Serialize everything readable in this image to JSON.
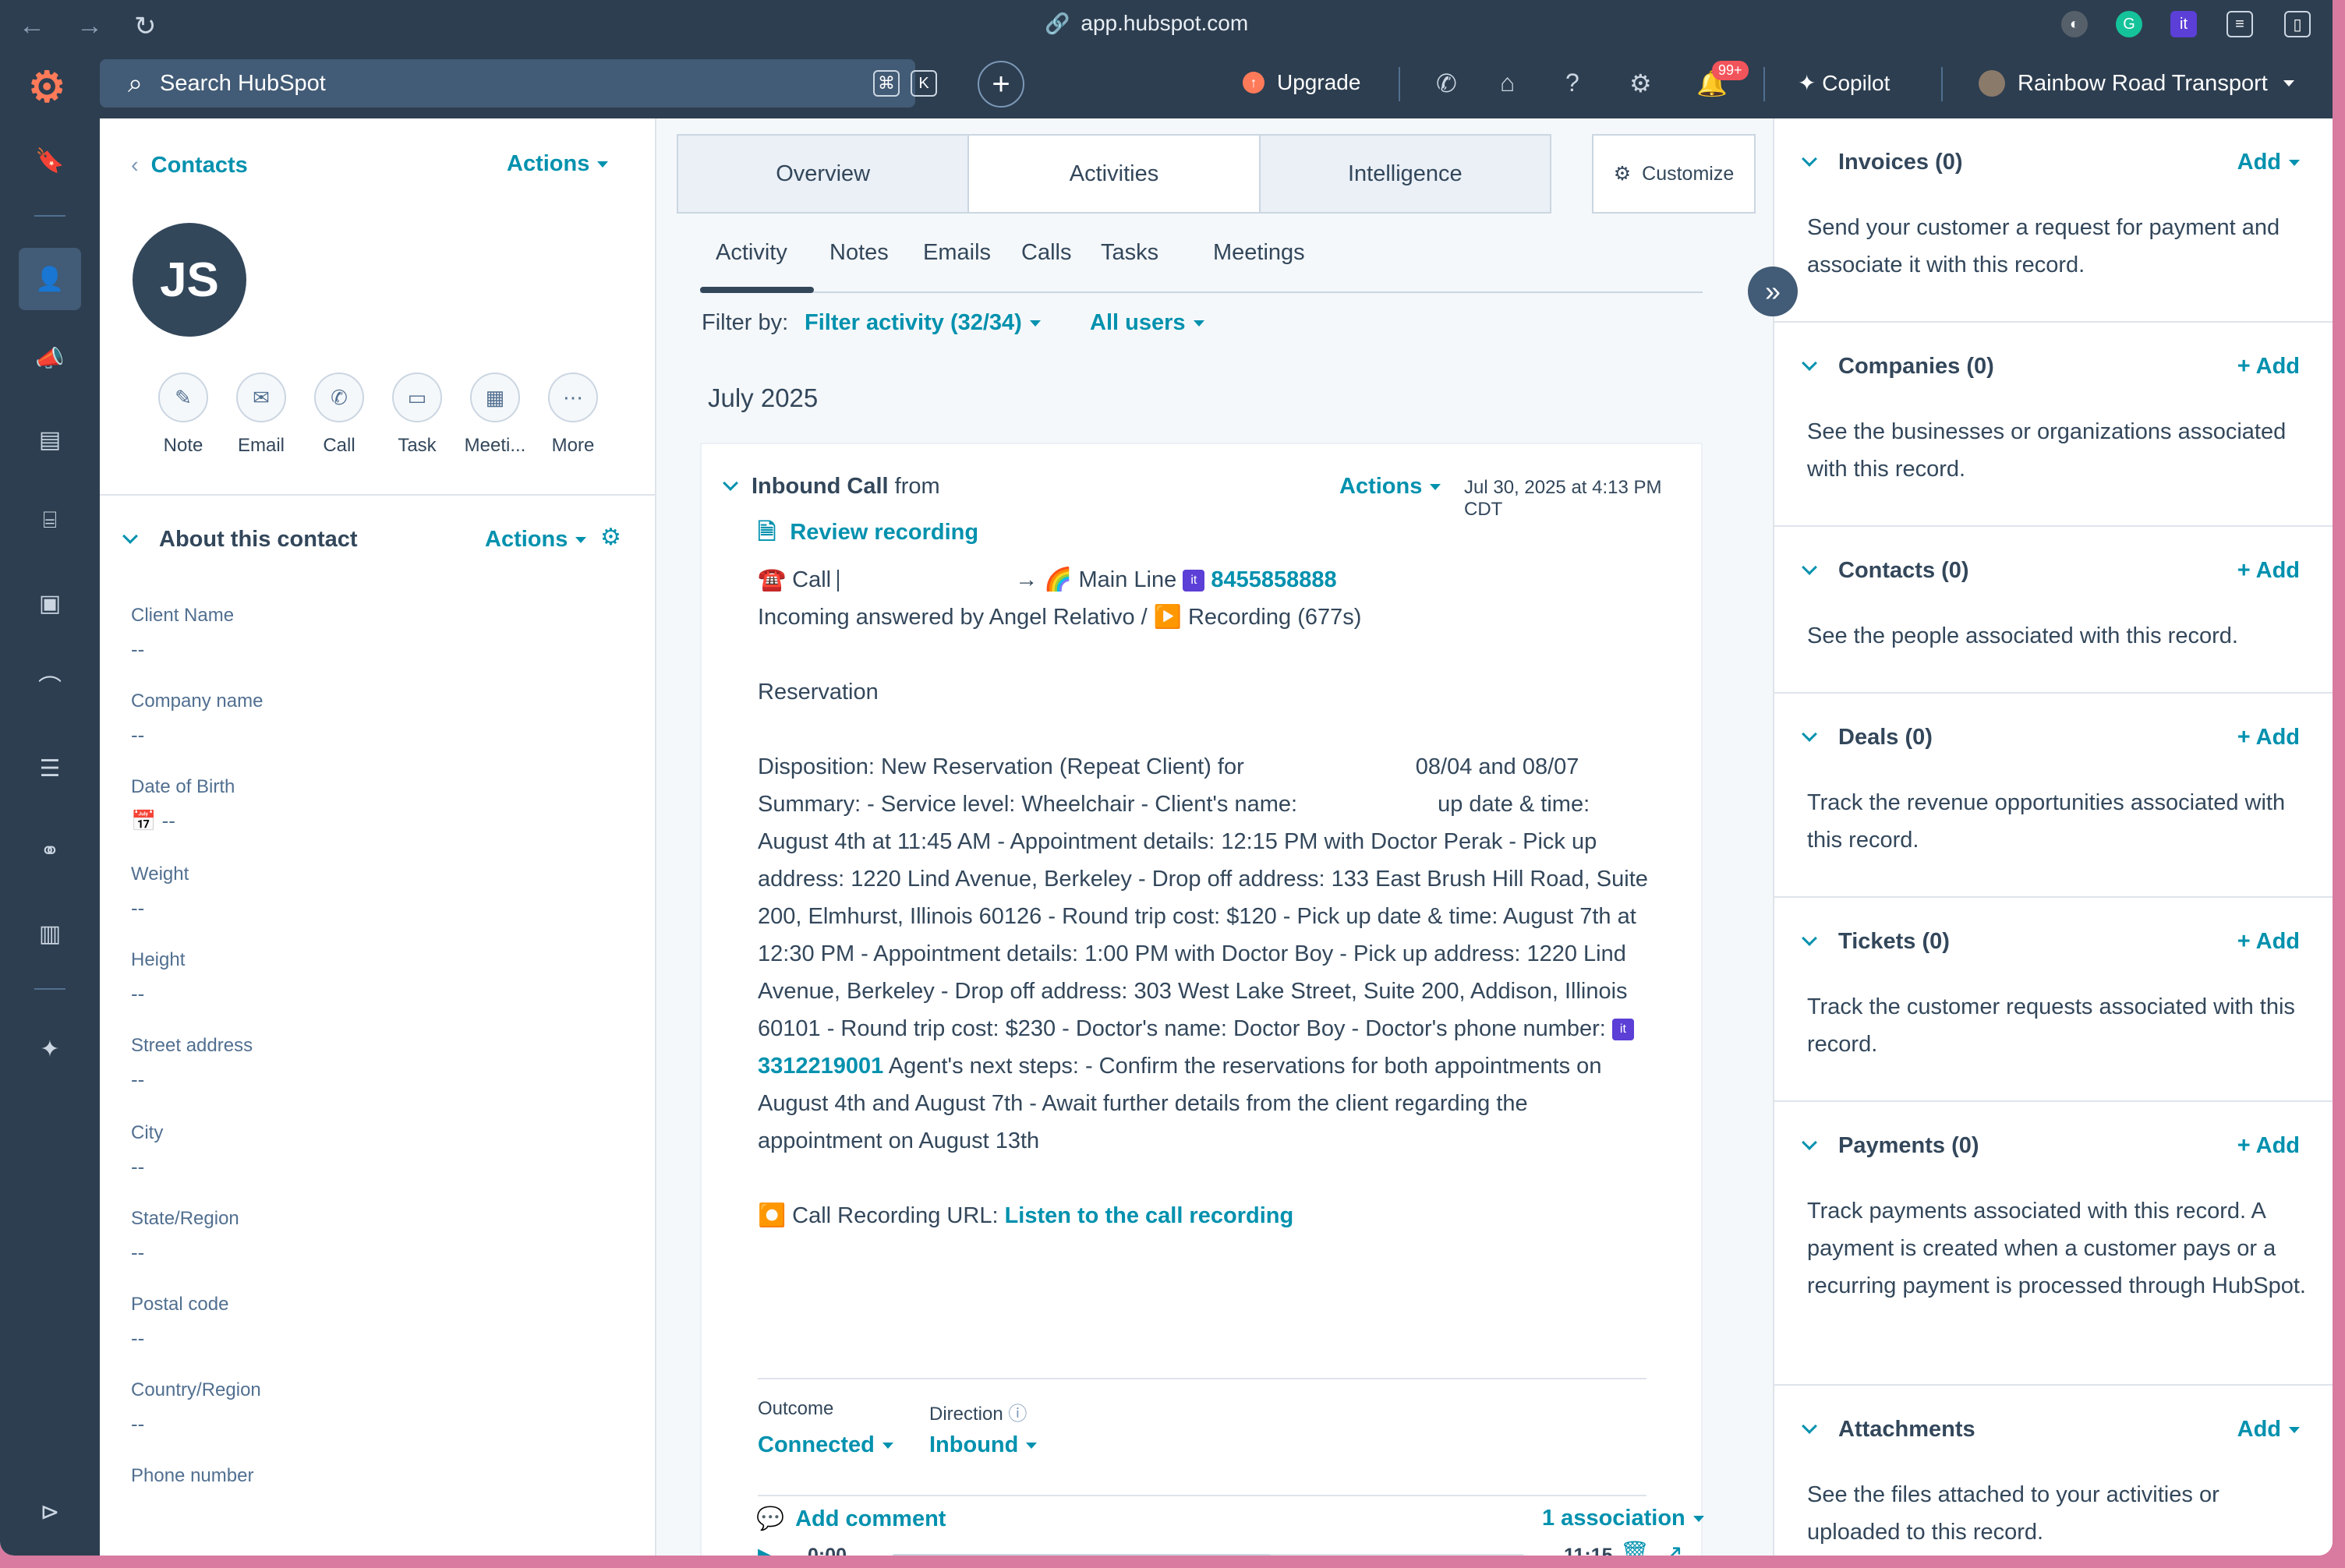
{
  "browser": {
    "url": "app.hubspot.com"
  },
  "topbar": {
    "search_placeholder": "Search HubSpot",
    "kbd1": "⌘",
    "kbd2": "K",
    "upgrade": "Upgrade",
    "notif_badge": "99+",
    "copilot": "Copilot",
    "account": "Rainbow Road Transport"
  },
  "contact": {
    "breadcrumb": "Contacts",
    "actions": "Actions",
    "initials": "JS",
    "quick_actions": [
      "Note",
      "Email",
      "Call",
      "Task",
      "Meeti...",
      "More"
    ],
    "about_title": "About this contact",
    "about_actions": "Actions",
    "fields": [
      {
        "label": "Client Name",
        "value": "--"
      },
      {
        "label": "Company name",
        "value": "--"
      },
      {
        "label": "Date of Birth",
        "value": "--"
      },
      {
        "label": "Weight",
        "value": "--"
      },
      {
        "label": "Height",
        "value": "--"
      },
      {
        "label": "Street address",
        "value": "--"
      },
      {
        "label": "City",
        "value": "--"
      },
      {
        "label": "State/Region",
        "value": "--"
      },
      {
        "label": "Postal code",
        "value": "--"
      },
      {
        "label": "Country/Region",
        "value": "--"
      },
      {
        "label": "Phone number",
        "value": ""
      }
    ]
  },
  "middle": {
    "tabs": [
      "Overview",
      "Activities",
      "Intelligence"
    ],
    "customize": "Customize",
    "subtabs": [
      "Activity",
      "Notes",
      "Emails",
      "Calls",
      "Tasks",
      "Meetings"
    ],
    "filter_label": "Filter by:",
    "filter_activity": "Filter activity (32/34)",
    "all_users": "All users",
    "month": "July 2025"
  },
  "activity": {
    "type": "Inbound Call",
    "from": "from",
    "actions": "Actions",
    "timestamp": "Jul 30, 2025 at 4:13 PM CDT",
    "review": "Review recording",
    "call_word": "Call",
    "main_line": "Main Line",
    "phone1": "8455858888",
    "answered": "Incoming answered by Angel Relativo / ▶️ Recording (677s)",
    "heading": "Reservation",
    "disposition_a": "Disposition: New Reservation (Repeat Client) for",
    "disposition_b": "08/04 and 08/07",
    "summary_a": "Summary: - Service level: Wheelchair - Client's name:",
    "summary_b": "up date & time:",
    "summary_lines": [
      "August 4th at 11:45 AM - Appointment details: 12:15 PM with Doctor Perak - Pick up",
      "address: 1220 Lind Avenue, Berkeley - Drop off address: 133 East Brush Hill Road, Suite",
      "200, Elmhurst, Illinois 60126 - Round trip cost: $120 - Pick up date & time: August 7th at",
      "12:30 PM - Appointment details: 1:00 PM with Doctor Boy - Pick up address: 1220 Lind",
      "Avenue, Berkeley - Drop off address: 303 West Lake Street, Suite 200, Addison, Illinois",
      "60101 - Round trip cost: $230 - Doctor's name: Doctor Boy - Doctor's phone number:"
    ],
    "phone2": "3312219001",
    "next_steps_a": "Agent's next steps: - Confirm the reservations for both appointments on",
    "next_steps_lines": [
      "August 4th and August 7th - Await further details from the client regarding the",
      "appointment on August 13th"
    ],
    "rec_url_label": "Call Recording URL:",
    "rec_url_link": "Listen to the call recording",
    "outcome_label": "Outcome",
    "outcome_value": "Connected",
    "direction_label": "Direction",
    "direction_value": "Inbound",
    "player_time": "0:00",
    "player_duration": "11:15",
    "player_progress": 0.6,
    "add_comment": "Add comment",
    "association": "1 association"
  },
  "right": {
    "sections": [
      {
        "title": "Invoices (0)",
        "add": "Add",
        "desc": "Send your customer a request for payment and associate it with this record."
      },
      {
        "title": "Companies (0)",
        "add": "+ Add",
        "desc": "See the businesses or organizations associated with this record."
      },
      {
        "title": "Contacts (0)",
        "add": "+ Add",
        "desc": "See the people associated with this record."
      },
      {
        "title": "Deals (0)",
        "add": "+ Add",
        "desc": "Track the revenue opportunities associated with this record."
      },
      {
        "title": "Tickets (0)",
        "add": "+ Add",
        "desc": "Track the customer requests associated with this record."
      },
      {
        "title": "Payments (0)",
        "add": "+ Add",
        "desc": "Track payments associated with this record. A payment is created when a customer pays or a recurring payment is processed through HubSpot."
      },
      {
        "title": "Attachments",
        "add": "Add",
        "desc": "See the files attached to your activities or uploaded to this record."
      }
    ]
  },
  "colors": {
    "accent": "#0091ae",
    "nav": "#2d3e50",
    "text": "#33475b"
  }
}
